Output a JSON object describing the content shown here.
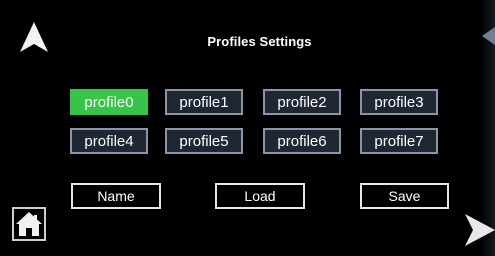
{
  "header": {
    "title": "Profiles Settings"
  },
  "profiles": [
    {
      "label": "profile0",
      "selected": true
    },
    {
      "label": "profile1",
      "selected": false
    },
    {
      "label": "profile2",
      "selected": false
    },
    {
      "label": "profile3",
      "selected": false
    },
    {
      "label": "profile4",
      "selected": false
    },
    {
      "label": "profile5",
      "selected": false
    },
    {
      "label": "profile6",
      "selected": false
    },
    {
      "label": "profile7",
      "selected": false
    }
  ],
  "actions": {
    "name_label": "Name",
    "load_label": "Load",
    "save_label": "Save"
  },
  "icons": {
    "nav_up": "up-arrow-icon",
    "nav_next": "right-arrow-icon",
    "nav_back": "left-arrow-icon",
    "home": "home-icon"
  },
  "colors": {
    "background": "#000000",
    "selected": "#38c349",
    "button_fill": "#1e2733",
    "button_border": "#8a96a6",
    "action_border": "#e6e6e6"
  }
}
